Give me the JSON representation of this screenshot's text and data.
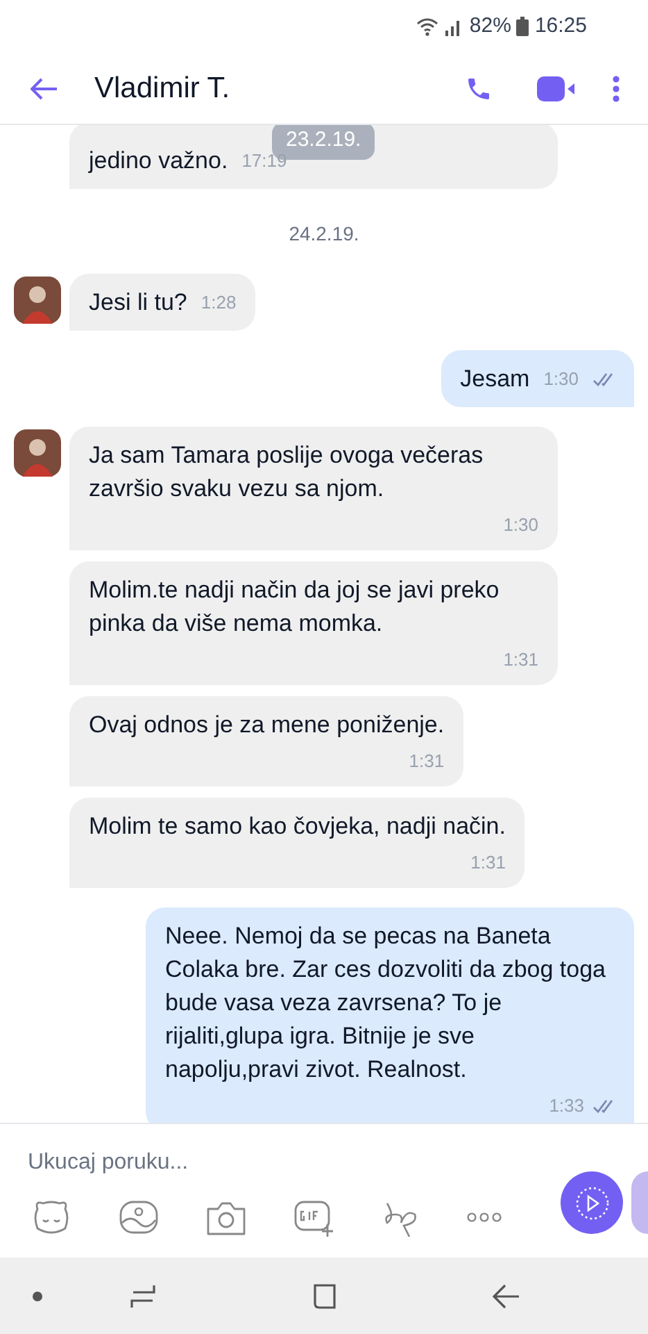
{
  "status_bar": {
    "battery": "82%",
    "time": "16:25"
  },
  "header": {
    "title": "Vladimir T."
  },
  "floating_date": "23.2.19.",
  "messages": [
    {
      "kind": "incoming",
      "avatar": false,
      "text": "jedino važno.",
      "time": "17:19"
    },
    {
      "kind": "date",
      "text": "24.2.19."
    },
    {
      "kind": "incoming",
      "avatar": true,
      "text": "Jesi li tu?",
      "time": "1:28"
    },
    {
      "kind": "outgoing",
      "text": "Jesam",
      "time": "1:30",
      "read": true
    },
    {
      "kind": "incoming",
      "avatar": true,
      "text": "Ja sam Tamara poslije ovoga večeras završio svaku vezu sa njom.",
      "time": "1:30"
    },
    {
      "kind": "incoming",
      "avatar": false,
      "text": "Molim.te nadji način da joj se javi preko pinka da više nema momka.",
      "time": "1:31"
    },
    {
      "kind": "incoming",
      "avatar": false,
      "text": "Ovaj odnos je za mene poniženje.",
      "time": "1:31"
    },
    {
      "kind": "incoming",
      "avatar": false,
      "text": "Molim te samo kao čovjeka, nadji način.",
      "time": "1:31"
    },
    {
      "kind": "outgoing",
      "text": "Neee. Nemoj da se pecas na Baneta Colaka bre. Zar ces dozvoliti da zbog toga bude vasa veza zavrsena? To je rijaliti,glupa igra. Bitnije je sve napolju,pravi zivot. Realnost.",
      "time": "1:33",
      "read": true
    }
  ],
  "composer": {
    "placeholder": "Ukucaj poruku..."
  }
}
